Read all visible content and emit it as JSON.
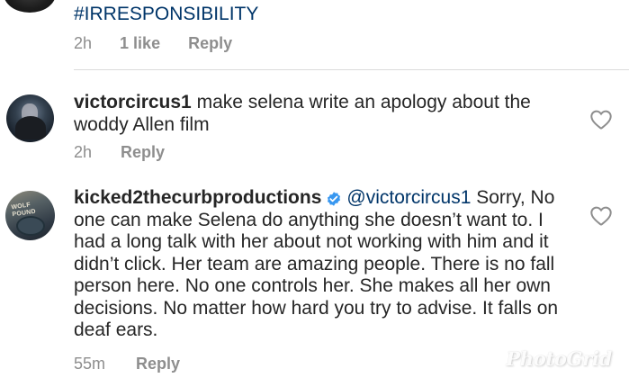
{
  "comments": [
    {
      "hashtag": "#IRRESPONSIBILITY",
      "time": "2h",
      "likes": "1 like",
      "reply": "Reply"
    },
    {
      "username": "victorcircus1",
      "text": " make selena write an apology about the woddy Allen film",
      "time": "2h",
      "reply": "Reply"
    },
    {
      "username": "kicked2thecurbproductions",
      "mention": "@victorcircus1",
      "text": " Sorry, No one can make Selena do anything she doesn’t want to. I had a long talk with her about not working with him and it didn’t click. Her team are amazing people. There is no fall person here. No one controls her. She makes all her own decisions. No matter how hard you try to advise. It falls on deaf ears.",
      "time": "55m",
      "reply": "Reply"
    }
  ],
  "avatar_labels": {
    "kicked": "WOLF POUND"
  },
  "watermark": "PhotoGrid",
  "colors": {
    "text": "#262626",
    "secondary": "#8e8e8e",
    "link": "#003569",
    "divider": "#dbdbdb",
    "verified": "#3897f0"
  },
  "icons": {
    "heart": "heart-outline-icon",
    "verified": "verified-badge-icon"
  }
}
